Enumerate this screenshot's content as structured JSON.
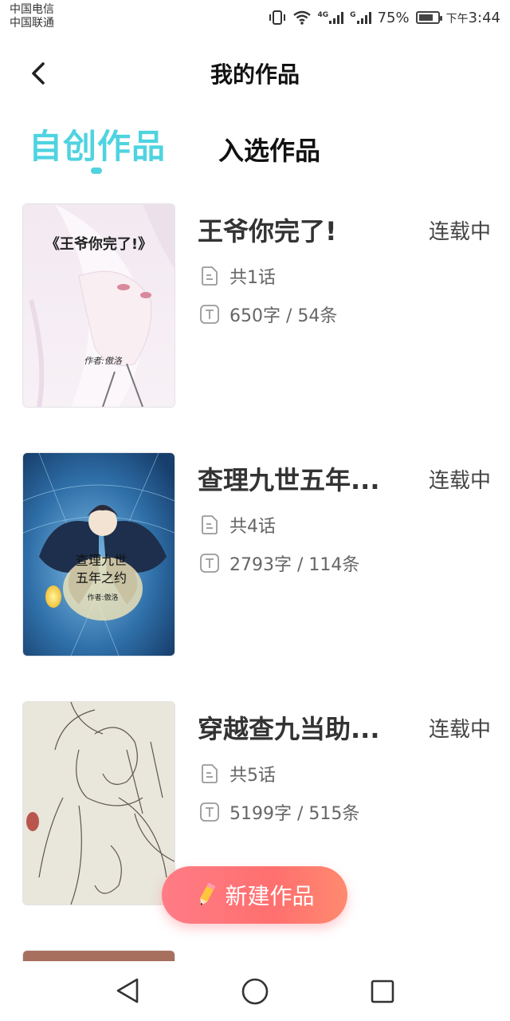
{
  "status_bar": {
    "carrier_1": "中国电信",
    "carrier_2": "中国联通",
    "net_1": "4G",
    "net_2": "G",
    "battery": "75%",
    "battery_level": 0.75,
    "time_prefix": "下午",
    "time": "3:44"
  },
  "header": {
    "title": "我的作品"
  },
  "tabs": [
    {
      "label": "自创作品",
      "active": true
    },
    {
      "label": "入选作品",
      "active": false
    }
  ],
  "works": [
    {
      "title": "王爷你完了!",
      "status": "连载中",
      "episodes": "共1话",
      "stats": "650字 / 54条",
      "cover": {
        "title_line1": "《王爷你完了!》",
        "author": "作者:傲洛"
      }
    },
    {
      "title": "查理九世五年...",
      "status": "连载中",
      "episodes": "共4话",
      "stats": "2793字 / 114条",
      "cover": {
        "title_line1": "查理九世",
        "title_line2": "五年之约",
        "author": "作者:傲洛"
      }
    },
    {
      "title": "穿越查九当助...",
      "status": "连载中",
      "episodes": "共5话",
      "stats": "5199字 / 515条",
      "cover": {}
    }
  ],
  "fab": {
    "label": "新建作品",
    "icon": "pencil-icon"
  },
  "nav": {
    "back": "back-triangle-icon",
    "home": "home-circle-icon",
    "recent": "recent-square-icon"
  },
  "colors": {
    "accent": "#4fd3e0",
    "fab": "#ff7278"
  }
}
